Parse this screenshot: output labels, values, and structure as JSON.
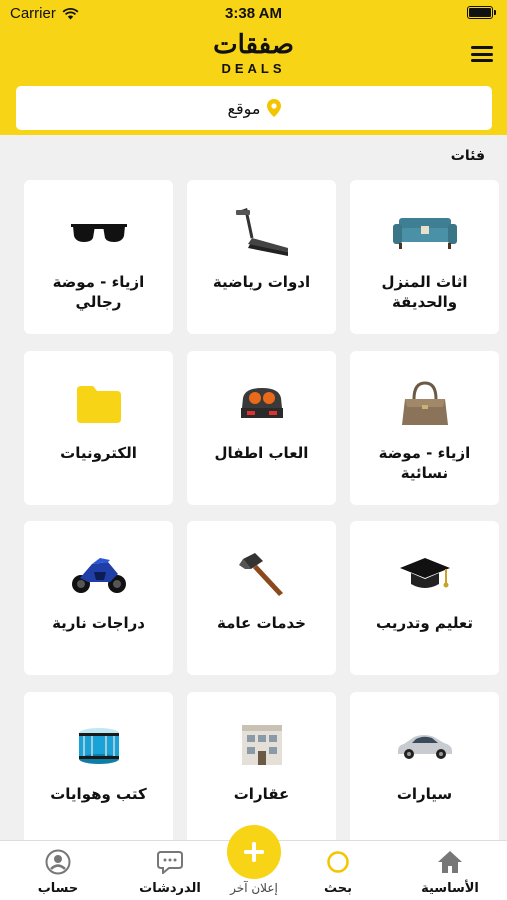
{
  "status_bar": {
    "carrier": "Carrier",
    "time": "3:38 AM"
  },
  "app": {
    "logo_arabic": "صفقات",
    "logo_english": "DEALS"
  },
  "location": {
    "label": "موقع"
  },
  "section": {
    "title": "فئات"
  },
  "categories": [
    {
      "label": "اثاث المنزل والحديقة",
      "icon": "sofa-icon"
    },
    {
      "label": "ادوات رياضية",
      "icon": "treadmill-icon"
    },
    {
      "label": "ازياء - موضة رجالي",
      "icon": "sunglasses-icon"
    },
    {
      "label": "ازياء - موضة نسائية",
      "icon": "handbag-icon"
    },
    {
      "label": "العاب اطفال",
      "icon": "toy-icon"
    },
    {
      "label": "الكترونيات",
      "icon": "folder-icon"
    },
    {
      "label": "تعليم وتدريب",
      "icon": "graduation-cap-icon"
    },
    {
      "label": "خدمات عامة",
      "icon": "hammer-icon"
    },
    {
      "label": "دراجات نارية",
      "icon": "motorcycle-icon"
    },
    {
      "label": "سيارات",
      "icon": "car-icon"
    },
    {
      "label": "عقارات",
      "icon": "building-icon"
    },
    {
      "label": "كتب وهوايات",
      "icon": "drum-icon"
    }
  ],
  "tabbar": {
    "home": "الأساسية",
    "search": "بحث",
    "add": "إعلان آخر",
    "chats": "الدردشات",
    "account": "حساب"
  },
  "colors": {
    "brand_yellow": "#f7d415",
    "background": "#f0f0f0"
  }
}
